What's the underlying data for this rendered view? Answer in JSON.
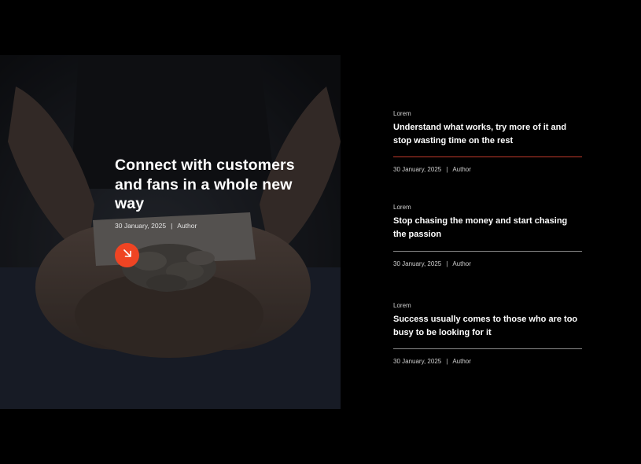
{
  "featured": {
    "title": "Connect with customers and fans in a whole new way",
    "date": "30 January, 2025",
    "separator": "|",
    "author": "Author",
    "button_icon": "arrow-down-right-icon",
    "accent_color": "#ef4423"
  },
  "posts": [
    {
      "category": "Lorem",
      "title": "Understand what works, try more of it and stop wasting time on the rest",
      "date": "30 January, 2025",
      "separator": "|",
      "author": "Author",
      "divider_color": "#c0392b"
    },
    {
      "category": "Lorem",
      "title": "Stop chasing the money and start chasing the passion",
      "date": "30 January, 2025",
      "separator": "|",
      "author": "Author",
      "divider_color": "#8a8a8a"
    },
    {
      "category": "Lorem",
      "title": "Success usually comes to those who are too busy to be looking for it",
      "date": "30 January, 2025",
      "separator": "|",
      "author": "Author",
      "divider_color": "#8a8a8a"
    }
  ]
}
